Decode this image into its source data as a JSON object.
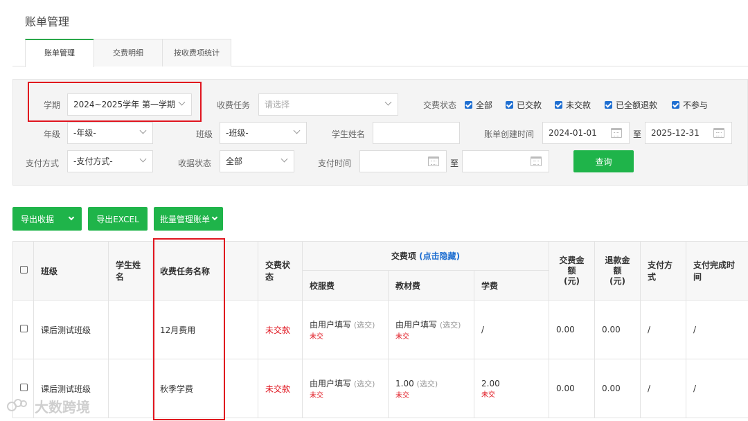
{
  "page": {
    "title": "账单管理"
  },
  "tabs": [
    {
      "label": "账单管理",
      "active": true
    },
    {
      "label": "交费明细",
      "active": false
    },
    {
      "label": "按收费项统计",
      "active": false
    }
  ],
  "filters": {
    "term": {
      "label": "学期",
      "value": "2024~2025学年 第一学期"
    },
    "task": {
      "label": "收费任务",
      "placeholder": "请选择"
    },
    "pay_status": {
      "label": "交费状态",
      "options": [
        {
          "label": "全部",
          "checked": true
        },
        {
          "label": "已交款",
          "checked": true
        },
        {
          "label": "未交款",
          "checked": true
        },
        {
          "label": "已全额退款",
          "checked": true
        },
        {
          "label": "不参与",
          "checked": true
        }
      ]
    },
    "grade": {
      "label": "年级",
      "value": "-年级-"
    },
    "class": {
      "label": "班级",
      "value": "-班级-"
    },
    "student": {
      "label": "学生姓名",
      "value": ""
    },
    "created": {
      "label": "账单创建时间",
      "from": "2024-01-01",
      "sep": "至",
      "to": "2025-12-31"
    },
    "pay_method": {
      "label": "支付方式",
      "value": "-支付方式-"
    },
    "receipt_status": {
      "label": "收据状态",
      "value": "全部"
    },
    "pay_time": {
      "label": "支付时间",
      "from": "",
      "sep": "至",
      "to": ""
    },
    "query_label": "查询"
  },
  "actions": {
    "export_receipt": "导出收据",
    "export_excel": "导出EXCEL",
    "batch_manage": "批量管理账单"
  },
  "table": {
    "headers": {
      "class": "班级",
      "student": "学生姓名",
      "task_name": "收费任务名称",
      "status": "交费状态",
      "items_group": "交费项",
      "items_toggle": "(点击隐藏)",
      "item_uniform": "校服费",
      "item_books": "教材费",
      "item_tuition": "学费",
      "amount": "交费金额\n(元)",
      "refund": "退款金额\n(元)",
      "method": "支付方式",
      "finish_time": "支付完成时间"
    },
    "rows": [
      {
        "class": "课后测试班级",
        "student": "",
        "task_name": "12月费用",
        "status": "未交款",
        "uniform_main": "由用户填写",
        "uniform_opt": "(选交)",
        "uniform_state": "未交",
        "books_main": "由用户填写",
        "books_opt": "(选交)",
        "books_state": "未交",
        "tuition_main": "/",
        "tuition_state": "",
        "amount": "0.00",
        "refund": "0.00",
        "method": "/",
        "finish_time": "/"
      },
      {
        "class": "课后测试班级",
        "student": "",
        "task_name": "秋季学费",
        "status": "未交款",
        "uniform_main": "由用户填写",
        "uniform_opt": "(选交)",
        "uniform_state": "未交",
        "books_main": "1.00",
        "books_opt": "(选交)",
        "books_state": "未交",
        "tuition_main": "2.00",
        "tuition_state": "未交",
        "amount": "0.00",
        "refund": "0.00",
        "method": "/",
        "finish_time": "/"
      }
    ]
  },
  "watermark": "大数跨境",
  "colors": {
    "accent_green": "#1fb44a",
    "highlight_red": "#e0141e",
    "link_blue": "#1f6fd1"
  }
}
